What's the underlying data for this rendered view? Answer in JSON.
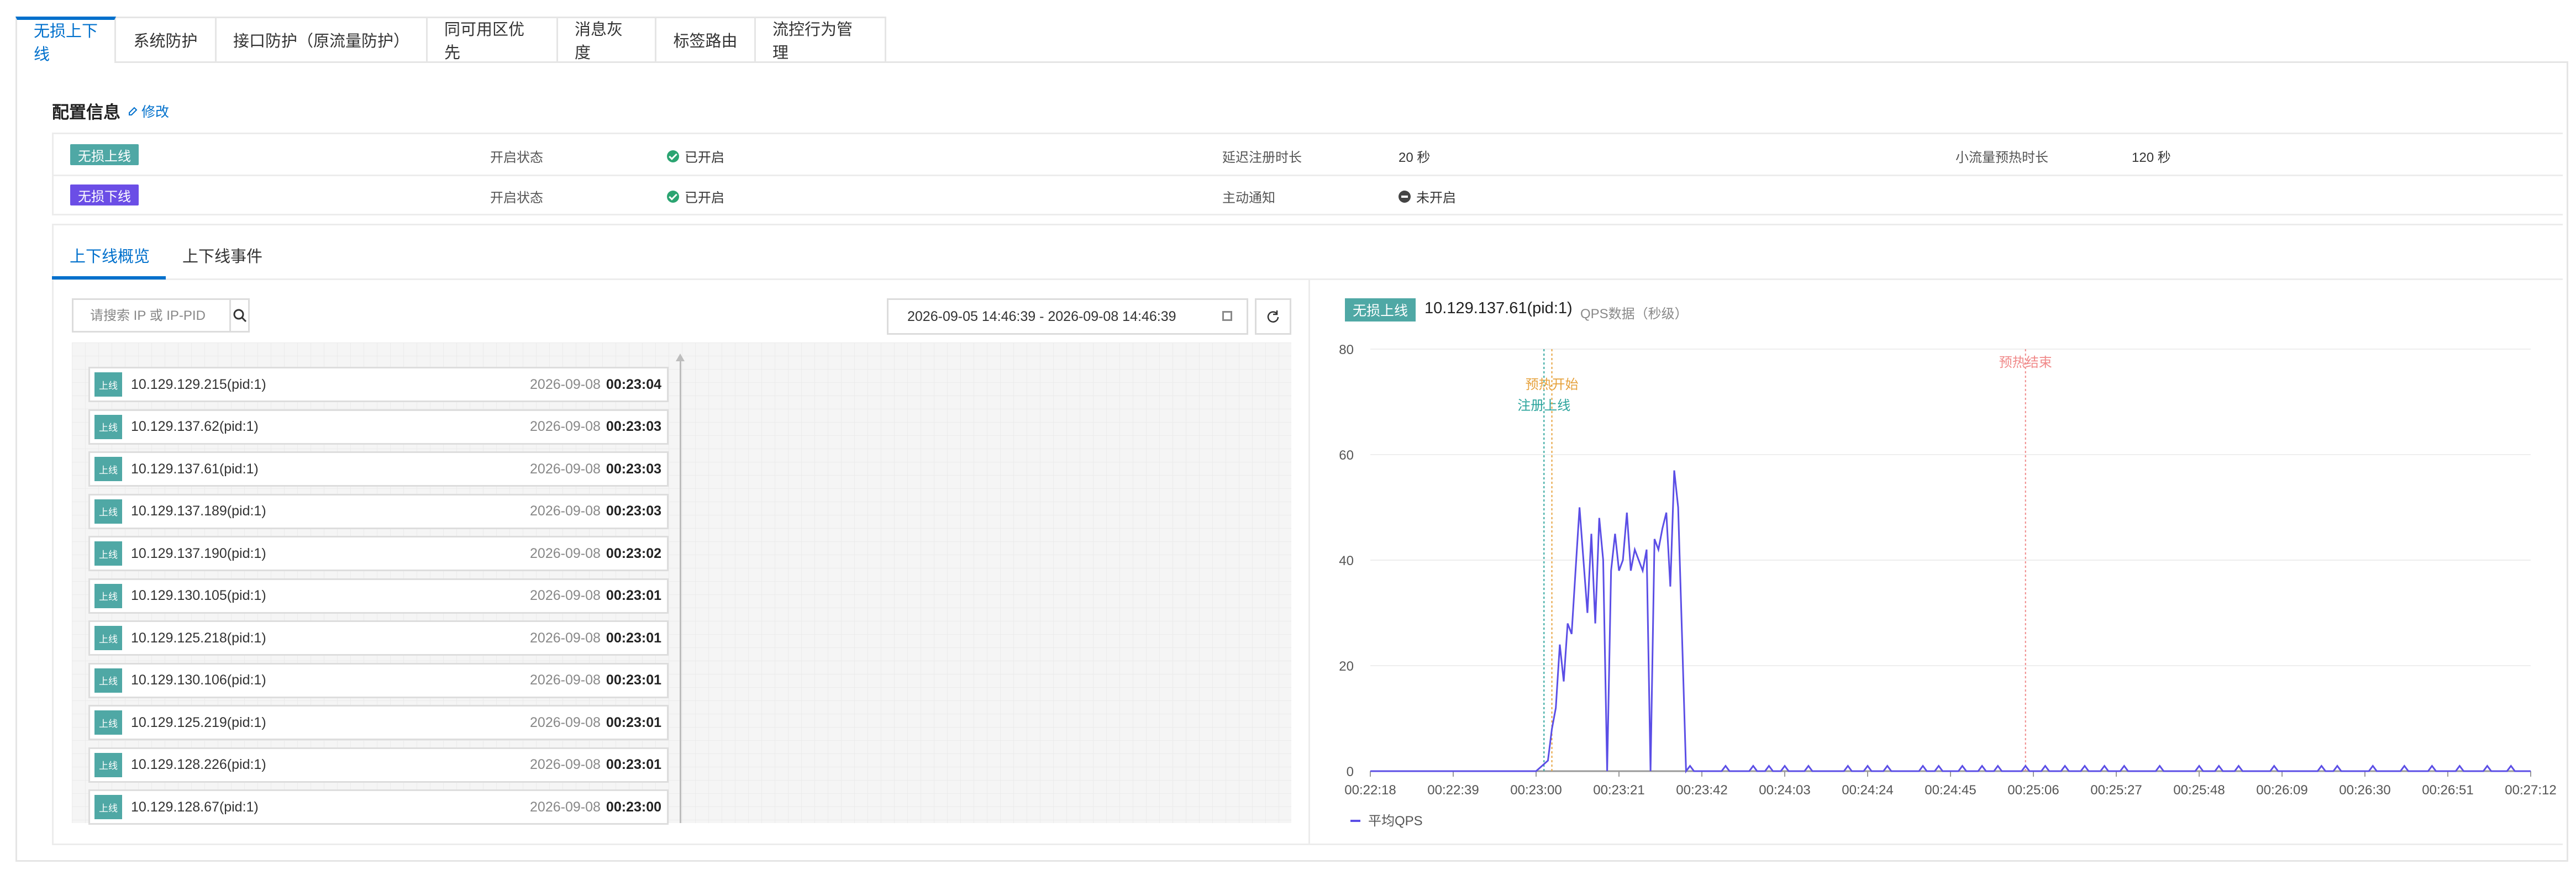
{
  "top_tabs": [
    "无损上下线",
    "系统防护",
    "接口防护（原流量防护）",
    "同可用区优先",
    "消息灰度",
    "标签路由",
    "流控行为管理"
  ],
  "config": {
    "title": "配置信息",
    "edit_label": "修改",
    "online": {
      "tag": "无损上线",
      "status_label": "开启状态",
      "status_value": "已开启",
      "delay_label": "延迟注册时长",
      "delay_value": "20 秒",
      "warmup_label": "小流量预热时长",
      "warmup_value": "120 秒"
    },
    "offline": {
      "tag": "无损下线",
      "status_label": "开启状态",
      "status_value": "已开启",
      "notify_label": "主动通知",
      "notify_value": "未开启"
    }
  },
  "sub_tabs": [
    "上下线概览",
    "上下线事件"
  ],
  "search": {
    "placeholder": "请搜索 IP 或 IP-PID"
  },
  "date_range": "2026-09-05 14:46:39 - 2026-09-08 14:46:39",
  "events": [
    {
      "tag": "上线",
      "ip": "10.129.129.215(pid:1)",
      "date": "2026-09-08",
      "time": "00:23:04"
    },
    {
      "tag": "上线",
      "ip": "10.129.137.62(pid:1)",
      "date": "2026-09-08",
      "time": "00:23:03"
    },
    {
      "tag": "上线",
      "ip": "10.129.137.61(pid:1)",
      "date": "2026-09-08",
      "time": "00:23:03"
    },
    {
      "tag": "上线",
      "ip": "10.129.137.189(pid:1)",
      "date": "2026-09-08",
      "time": "00:23:03"
    },
    {
      "tag": "上线",
      "ip": "10.129.137.190(pid:1)",
      "date": "2026-09-08",
      "time": "00:23:02"
    },
    {
      "tag": "上线",
      "ip": "10.129.130.105(pid:1)",
      "date": "2026-09-08",
      "time": "00:23:01"
    },
    {
      "tag": "上线",
      "ip": "10.129.125.218(pid:1)",
      "date": "2026-09-08",
      "time": "00:23:01"
    },
    {
      "tag": "上线",
      "ip": "10.129.130.106(pid:1)",
      "date": "2026-09-08",
      "time": "00:23:01"
    },
    {
      "tag": "上线",
      "ip": "10.129.125.219(pid:1)",
      "date": "2026-09-08",
      "time": "00:23:01"
    },
    {
      "tag": "上线",
      "ip": "10.129.128.226(pid:1)",
      "date": "2026-09-08",
      "time": "00:23:01"
    },
    {
      "tag": "上线",
      "ip": "10.129.128.67(pid:1)",
      "date": "2026-09-08",
      "time": "00:23:00"
    }
  ],
  "chart_header": {
    "tag": "无损上线",
    "ip": "10.129.137.61(pid:1)",
    "subtitle": "QPS数据（秒级）"
  },
  "colors": {
    "accent": "#0070cc",
    "teal": "#4fa8a5",
    "purple": "#6b4ee6",
    "line": "#5b4ee6",
    "warmup_start": "#e6a23c",
    "register": "#2ba49c",
    "warmup_end": "#f08a8a"
  },
  "chart_data": {
    "type": "line",
    "title": "",
    "xlabel": "",
    "ylabel": "",
    "ylim": [
      0,
      80
    ],
    "yticks": [
      0,
      20,
      40,
      60,
      80
    ],
    "x_ticks": [
      "00:22:18",
      "00:22:39",
      "00:23:00",
      "00:23:21",
      "00:23:42",
      "00:24:03",
      "00:24:24",
      "00:24:45",
      "00:25:06",
      "00:25:27",
      "00:25:48",
      "00:26:09",
      "00:26:30",
      "00:26:51",
      "00:27:12"
    ],
    "x_start_sec": 1338,
    "x_end_sec": 1632,
    "markers": [
      {
        "label": "注册上线",
        "sec": 1382,
        "color_key": "register"
      },
      {
        "label": "预热开始",
        "sec": 1384,
        "color_key": "warmup_start"
      },
      {
        "label": "预热结束",
        "sec": 1504,
        "color_key": "warmup_end"
      }
    ],
    "legend": [
      "平均QPS"
    ],
    "series": [
      {
        "name": "平均QPS",
        "points": [
          [
            1338,
            0
          ],
          [
            1380,
            0
          ],
          [
            1383,
            2
          ],
          [
            1384,
            8
          ],
          [
            1385,
            12
          ],
          [
            1386,
            24
          ],
          [
            1387,
            17
          ],
          [
            1388,
            28
          ],
          [
            1389,
            26
          ],
          [
            1390,
            38
          ],
          [
            1391,
            50
          ],
          [
            1392,
            40
          ],
          [
            1393,
            30
          ],
          [
            1394,
            45
          ],
          [
            1395,
            28
          ],
          [
            1396,
            48
          ],
          [
            1397,
            40
          ],
          [
            1398,
            0
          ],
          [
            1399,
            38
          ],
          [
            1400,
            45
          ],
          [
            1401,
            38
          ],
          [
            1402,
            40
          ],
          [
            1403,
            49
          ],
          [
            1404,
            38
          ],
          [
            1405,
            42
          ],
          [
            1406,
            40
          ],
          [
            1407,
            38
          ],
          [
            1408,
            42
          ],
          [
            1409,
            0
          ],
          [
            1410,
            44
          ],
          [
            1411,
            42
          ],
          [
            1412,
            46
          ],
          [
            1413,
            49
          ],
          [
            1414,
            35
          ],
          [
            1415,
            57
          ],
          [
            1416,
            50
          ],
          [
            1417,
            25
          ],
          [
            1418,
            0
          ],
          [
            1419,
            1
          ],
          [
            1420,
            0
          ],
          [
            1427,
            0
          ],
          [
            1428,
            1
          ],
          [
            1429,
            0
          ],
          [
            1434,
            0
          ],
          [
            1435,
            1
          ],
          [
            1436,
            0
          ],
          [
            1438,
            0
          ],
          [
            1439,
            1
          ],
          [
            1440,
            0
          ],
          [
            1442,
            0
          ],
          [
            1443,
            1
          ],
          [
            1444,
            0
          ],
          [
            1448,
            0
          ],
          [
            1449,
            1
          ],
          [
            1450,
            0
          ],
          [
            1458,
            0
          ],
          [
            1459,
            1
          ],
          [
            1460,
            0
          ],
          [
            1463,
            0
          ],
          [
            1464,
            1
          ],
          [
            1465,
            0
          ],
          [
            1468,
            0
          ],
          [
            1469,
            1
          ],
          [
            1470,
            0
          ],
          [
            1477,
            0
          ],
          [
            1478,
            1
          ],
          [
            1479,
            0
          ],
          [
            1481,
            0
          ],
          [
            1482,
            1
          ],
          [
            1483,
            0
          ],
          [
            1487,
            0
          ],
          [
            1488,
            1
          ],
          [
            1489,
            0
          ],
          [
            1492,
            0
          ],
          [
            1493,
            1
          ],
          [
            1494,
            0
          ],
          [
            1496,
            0
          ],
          [
            1497,
            1
          ],
          [
            1498,
            0
          ],
          [
            1503,
            0
          ],
          [
            1504,
            1
          ],
          [
            1505,
            0
          ],
          [
            1508,
            0
          ],
          [
            1509,
            1
          ],
          [
            1510,
            0
          ],
          [
            1513,
            0
          ],
          [
            1514,
            1
          ],
          [
            1515,
            0
          ],
          [
            1518,
            0
          ],
          [
            1519,
            1
          ],
          [
            1520,
            0
          ],
          [
            1523,
            0
          ],
          [
            1524,
            1
          ],
          [
            1525,
            0
          ],
          [
            1528,
            0
          ],
          [
            1529,
            1
          ],
          [
            1530,
            0
          ],
          [
            1537,
            0
          ],
          [
            1538,
            1
          ],
          [
            1539,
            0
          ],
          [
            1547,
            0
          ],
          [
            1548,
            1
          ],
          [
            1549,
            0
          ],
          [
            1552,
            0
          ],
          [
            1553,
            1
          ],
          [
            1554,
            0
          ],
          [
            1557,
            0
          ],
          [
            1558,
            1
          ],
          [
            1559,
            0
          ],
          [
            1566,
            0
          ],
          [
            1567,
            1
          ],
          [
            1568,
            0
          ],
          [
            1578,
            0
          ],
          [
            1579,
            1
          ],
          [
            1580,
            0
          ],
          [
            1582,
            0
          ],
          [
            1583,
            1
          ],
          [
            1584,
            0
          ],
          [
            1591,
            0
          ],
          [
            1592,
            1
          ],
          [
            1593,
            0
          ],
          [
            1599,
            0
          ],
          [
            1600,
            1
          ],
          [
            1601,
            0
          ],
          [
            1606,
            0
          ],
          [
            1607,
            1
          ],
          [
            1608,
            0
          ],
          [
            1613,
            0
          ],
          [
            1614,
            1
          ],
          [
            1615,
            0
          ],
          [
            1620,
            0
          ],
          [
            1621,
            1
          ],
          [
            1622,
            0
          ],
          [
            1626,
            0
          ],
          [
            1627,
            1
          ],
          [
            1628,
            0
          ],
          [
            1632,
            0
          ]
        ]
      }
    ]
  }
}
